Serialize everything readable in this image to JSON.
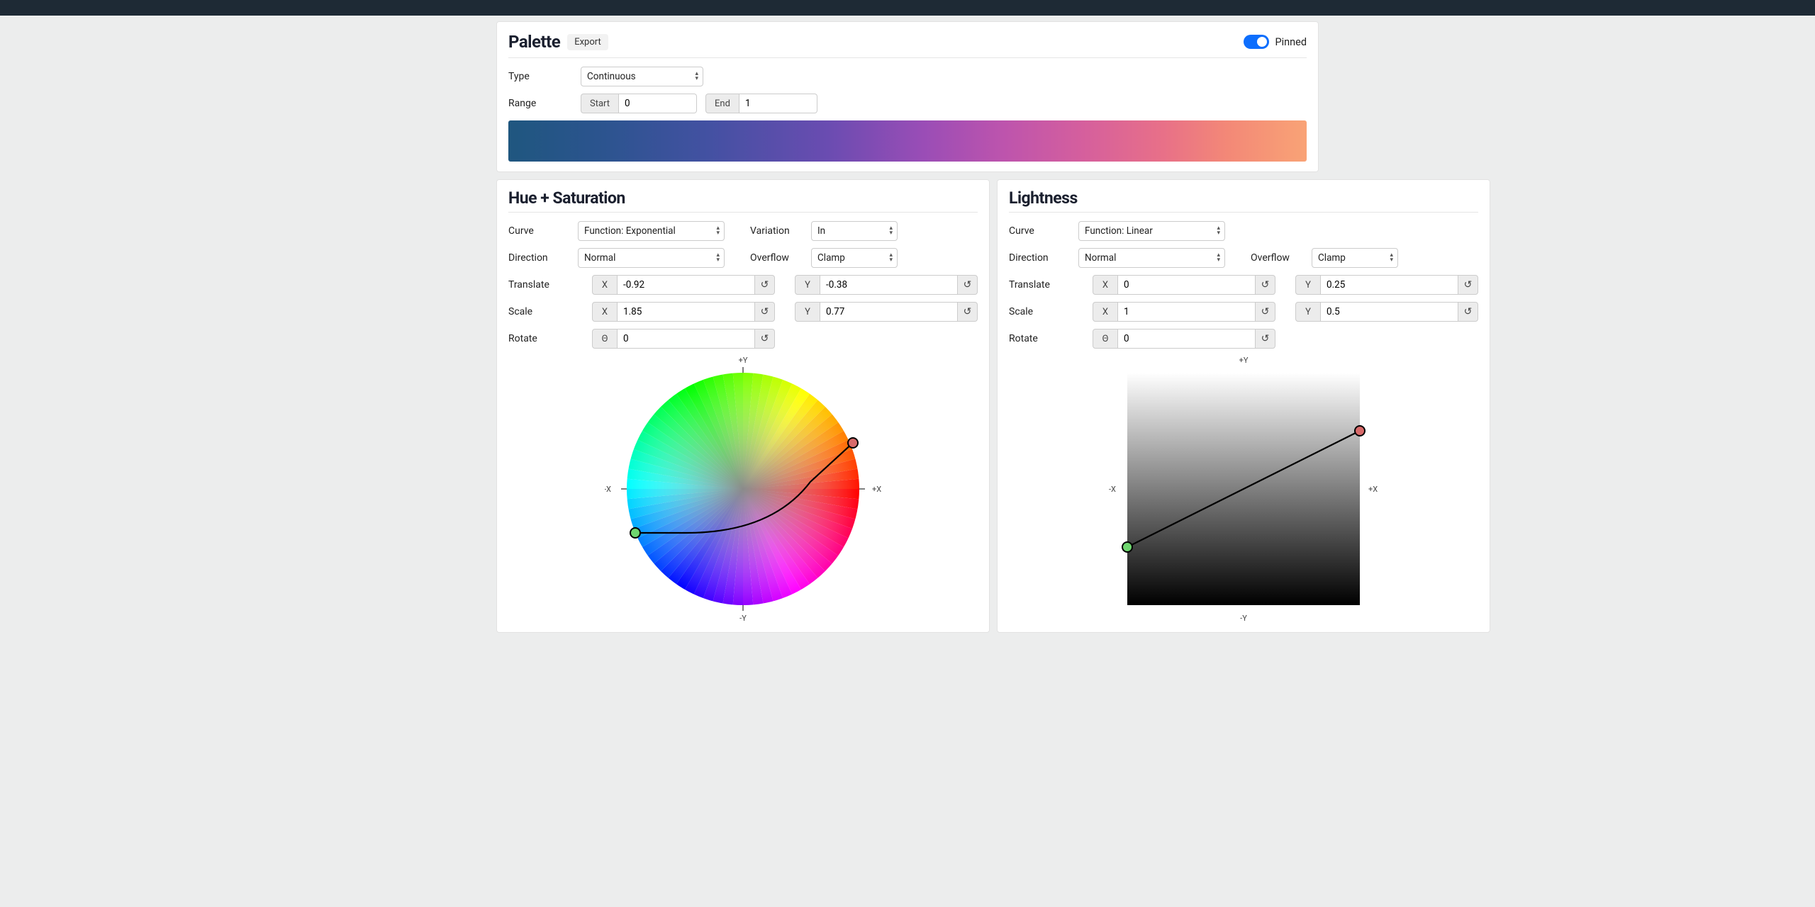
{
  "palette": {
    "title": "Palette",
    "export": "Export",
    "pinned": "Pinned",
    "type_label": "Type",
    "type_value": "Continuous",
    "range_label": "Range",
    "start_label": "Start",
    "start_value": "0",
    "end_label": "End",
    "end_value": "1"
  },
  "hs": {
    "title": "Hue + Saturation",
    "curve_label": "Curve",
    "curve_value": "Function: Exponential",
    "variation_label": "Variation",
    "variation_value": "In",
    "direction_label": "Direction",
    "direction_value": "Normal",
    "overflow_label": "Overflow",
    "overflow_value": "Clamp",
    "translate_label": "Translate",
    "tx": "-0.92",
    "ty": "-0.38",
    "scale_label": "Scale",
    "sx": "1.85",
    "sy": "0.77",
    "rotate_label": "Rotate",
    "rot": "0"
  },
  "lt": {
    "title": "Lightness",
    "curve_label": "Curve",
    "curve_value": "Function: Linear",
    "direction_label": "Direction",
    "direction_value": "Normal",
    "overflow_label": "Overflow",
    "overflow_value": "Clamp",
    "translate_label": "Translate",
    "tx": "0",
    "ty": "0.25",
    "scale_label": "Scale",
    "sx": "1",
    "sy": "0.5",
    "rotate_label": "Rotate",
    "rot": "0"
  },
  "axis": {
    "px": "+X",
    "nx": "-X",
    "py": "+Y",
    "ny": "-Y"
  },
  "reset_icon": "↺",
  "theta": "Θ"
}
